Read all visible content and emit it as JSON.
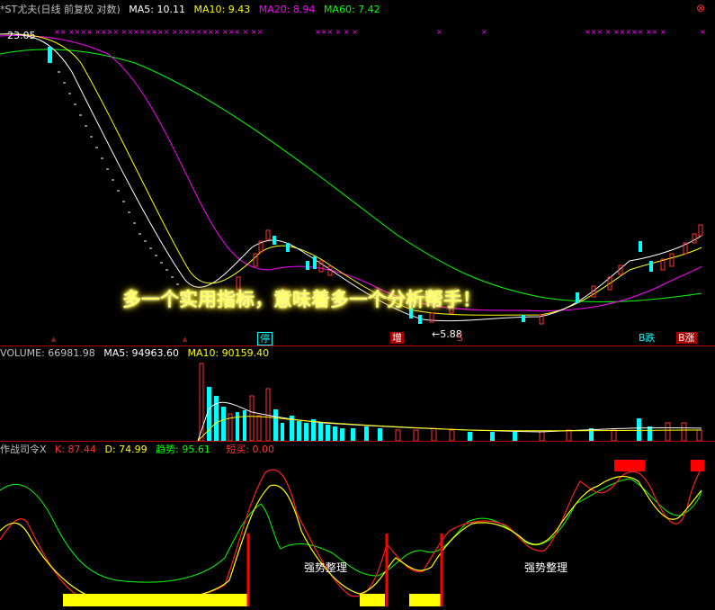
{
  "price_panel": {
    "stock_name": "*ST尤夫(日线 前复权 对数)",
    "ma5": "MA5: 10.11",
    "ma10": "MA10: 9.43",
    "ma20": "MA20: 8.94",
    "ma60": "MA60: 7.42",
    "high_label": "23.05",
    "low_label": "5.88",
    "markers": [
      "停",
      "增",
      "S",
      "B跌",
      "B涨"
    ],
    "banner": "多一个实用指标，意味着多一个分析帮手！",
    "colors": {
      "ma5": "#ffffff",
      "ma10": "#ffff00",
      "ma20": "#ff00ff",
      "ma60": "#00ff00",
      "up": "#ff3333",
      "down": "#00ffff"
    }
  },
  "volume_panel": {
    "volume": "VOLUME: 66981.98",
    "ma5": "MA5: 94963.60",
    "ma10": "MA10: 90159.40"
  },
  "indicator_panel": {
    "name": "作战司令X",
    "k": "K: 87.44",
    "d": "D: 74.99",
    "trend": "趋势: 95.61",
    "short_buy": "短买: 0.00",
    "annotations": [
      "强势整理",
      "强势整理"
    ]
  }
}
